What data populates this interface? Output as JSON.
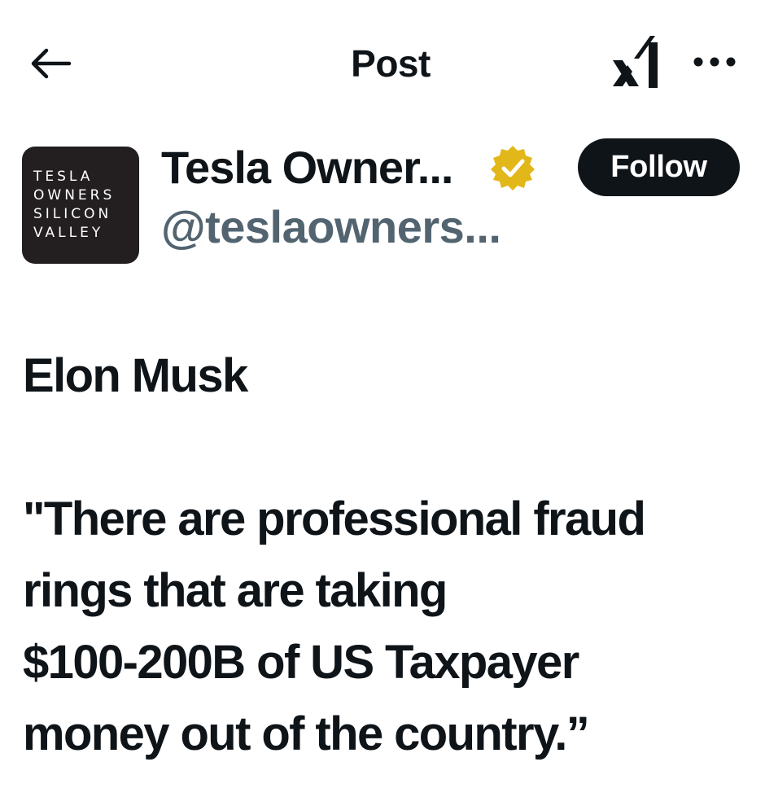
{
  "header": {
    "title": "Post",
    "back_icon": "arrow-left-icon",
    "grok_icon": "xai-logo-icon",
    "more_icon": "more-horizontal-icon"
  },
  "author": {
    "display_name": "Tesla Owner...",
    "handle": "@teslaowners...",
    "verified_badge_color": "#E2B719",
    "avatar_lines": [
      "TESLA",
      "OWNERS",
      "SILICON",
      "VALLEY"
    ],
    "avatar_bg": "#231F20",
    "follow_label": "Follow"
  },
  "post": {
    "lines": [
      "Elon Musk",
      "",
      "\"There are professional fraud",
      "rings that are taking",
      "$100-200B of US Taxpayer",
      "money out of the country.”"
    ]
  }
}
